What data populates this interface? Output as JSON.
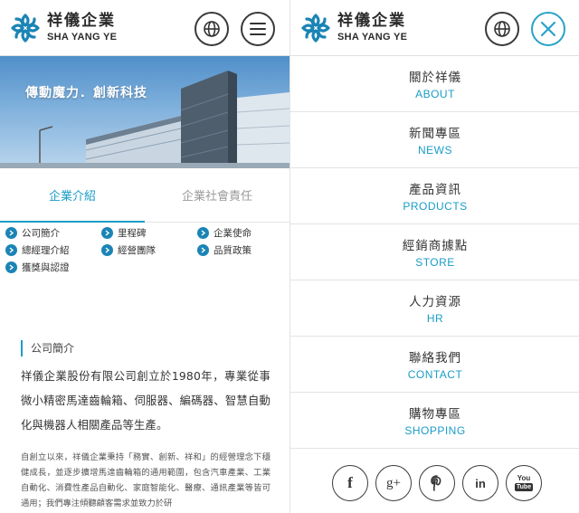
{
  "brand": {
    "name_cn": "祥儀企業",
    "name_en": "SHA YANG YE"
  },
  "banner": {
    "slogan": "傳動魔力．創新科技",
    "building_sign": "祥儀企業"
  },
  "tabs": [
    {
      "label": "企業介紹",
      "active": true
    },
    {
      "label": "企業社會責任",
      "active": false
    }
  ],
  "quick_links": [
    "公司簡介",
    "里程碑",
    "企業使命",
    "總經理介紹",
    "經營團隊",
    "品質政策",
    "獲獎與認證"
  ],
  "section": {
    "title": "公司簡介",
    "lead": "祥儀企業股份有限公司創立於1980年，專業從事微小精密馬達齒輪箱、伺服器、編碼器、智慧自動化與機器人相關產品等生產。",
    "body": "自創立以來，祥儀企業秉持「務實、創新、祥和」的經營理念下穩健成長，並逐步擴增馬達齒輪箱的通用範圍，包含汽車產業、工業自動化、消費性產品自動化、家庭智能化、醫療、通訊產業等皆可通用；我們專注傾聽顧客需求並致力於研"
  },
  "nav": [
    {
      "cn": "關於祥儀",
      "en": "ABOUT"
    },
    {
      "cn": "新聞專區",
      "en": "NEWS"
    },
    {
      "cn": "產品資訊",
      "en": "PRODUCTS"
    },
    {
      "cn": "經銷商據點",
      "en": "STORE"
    },
    {
      "cn": "人力資源",
      "en": "HR"
    },
    {
      "cn": "聯絡我們",
      "en": "CONTACT"
    },
    {
      "cn": "購物專區",
      "en": "SHOPPING"
    }
  ],
  "social": {
    "facebook": "f",
    "googleplus": "g+",
    "linkedin": "in",
    "youtube_top": "You",
    "youtube_bottom": "Tube"
  },
  "icons": {
    "logo": "logo-mark-icon",
    "globe": "globe-icon",
    "menu": "hamburger-icon",
    "close": "close-icon",
    "bullet": "chevron-right-icon"
  },
  "colors": {
    "accent": "#1a9cc7",
    "bullet": "#1b84b5",
    "text": "#333333",
    "border": "#e3e3e3"
  }
}
